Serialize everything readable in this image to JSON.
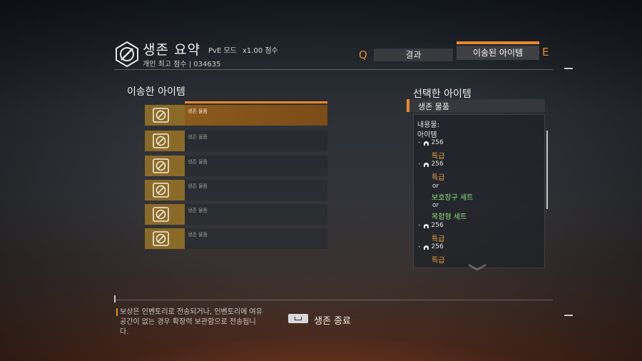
{
  "header": {
    "title": "생존 요약",
    "mode": "PvE 모드",
    "multiplier": "x1.00 점수",
    "best_score": "개인 최고 점수 | 034635"
  },
  "tabs": {
    "key_left": "Q",
    "key_right": "E",
    "result": "결과",
    "moved_items": "이송된 아이템"
  },
  "left_panel": {
    "title": "이송한 아이템",
    "items": [
      {
        "label": "생존 물품",
        "selected": true
      },
      {
        "label": "생존 물품",
        "selected": false
      },
      {
        "label": "생존 물품",
        "selected": false
      },
      {
        "label": "생존 물품",
        "selected": false
      },
      {
        "label": "생존 물품",
        "selected": false
      },
      {
        "label": "생존 물품",
        "selected": false
      }
    ]
  },
  "right_panel": {
    "title": "선택한 아이템",
    "header": "생존 물품",
    "contents_label": "내용물:",
    "items_label": "아이템",
    "entries": [
      {
        "score": "256",
        "quality": "특급"
      },
      {
        "score": "256",
        "quality": "특급"
      },
      {
        "or_1": "or",
        "set_1": "보호장구 세트",
        "or_2": "or",
        "set_2": "복합형 세트"
      },
      {
        "score": "256",
        "quality": "특급"
      },
      {
        "score": "256",
        "quality": "특급"
      }
    ]
  },
  "footer": {
    "note": "보상은 인벤토리로 전송되거나, 인벤토리에 여유 공간이 없는 경우 확장력 보관함으로 전송됩니다.",
    "exit_button": "생존 종료"
  },
  "colors": {
    "accent": "#e8892a",
    "quality_orange": "#e8a23a",
    "set_green": "#8ee07a",
    "item_icon_bg": "#8a6a28"
  }
}
